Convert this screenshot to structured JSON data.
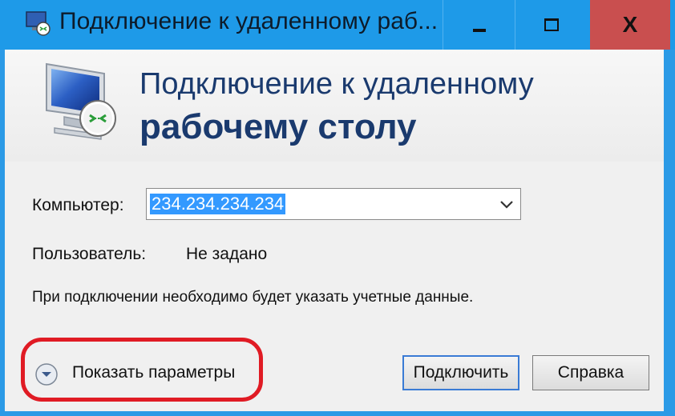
{
  "window": {
    "title": "Подключение к удаленному раб...",
    "controls": {
      "minimize_icon": "minimize-icon",
      "maximize_icon": "maximize-icon",
      "close_glyph": "X"
    }
  },
  "banner": {
    "line1": "Подключение к удаленному",
    "line2": "рабочему столу",
    "icon": "monitor-remote-icon"
  },
  "form": {
    "computer_label": "Компьютер:",
    "computer_value": "234.234.234.234",
    "user_label": "Пользователь:",
    "user_value": "Не задано",
    "info_text": "При подключении необходимо будет указать учетные данные."
  },
  "footer": {
    "show_options_label": "Показать параметры",
    "connect_label": "Подключить",
    "help_label": "Справка"
  },
  "colors": {
    "titlebar": "#1e9ae8",
    "close_button": "#c94f4f",
    "selection": "#3399ff",
    "banner_text": "#1a3a6e",
    "highlight_ring": "#e01b24"
  }
}
